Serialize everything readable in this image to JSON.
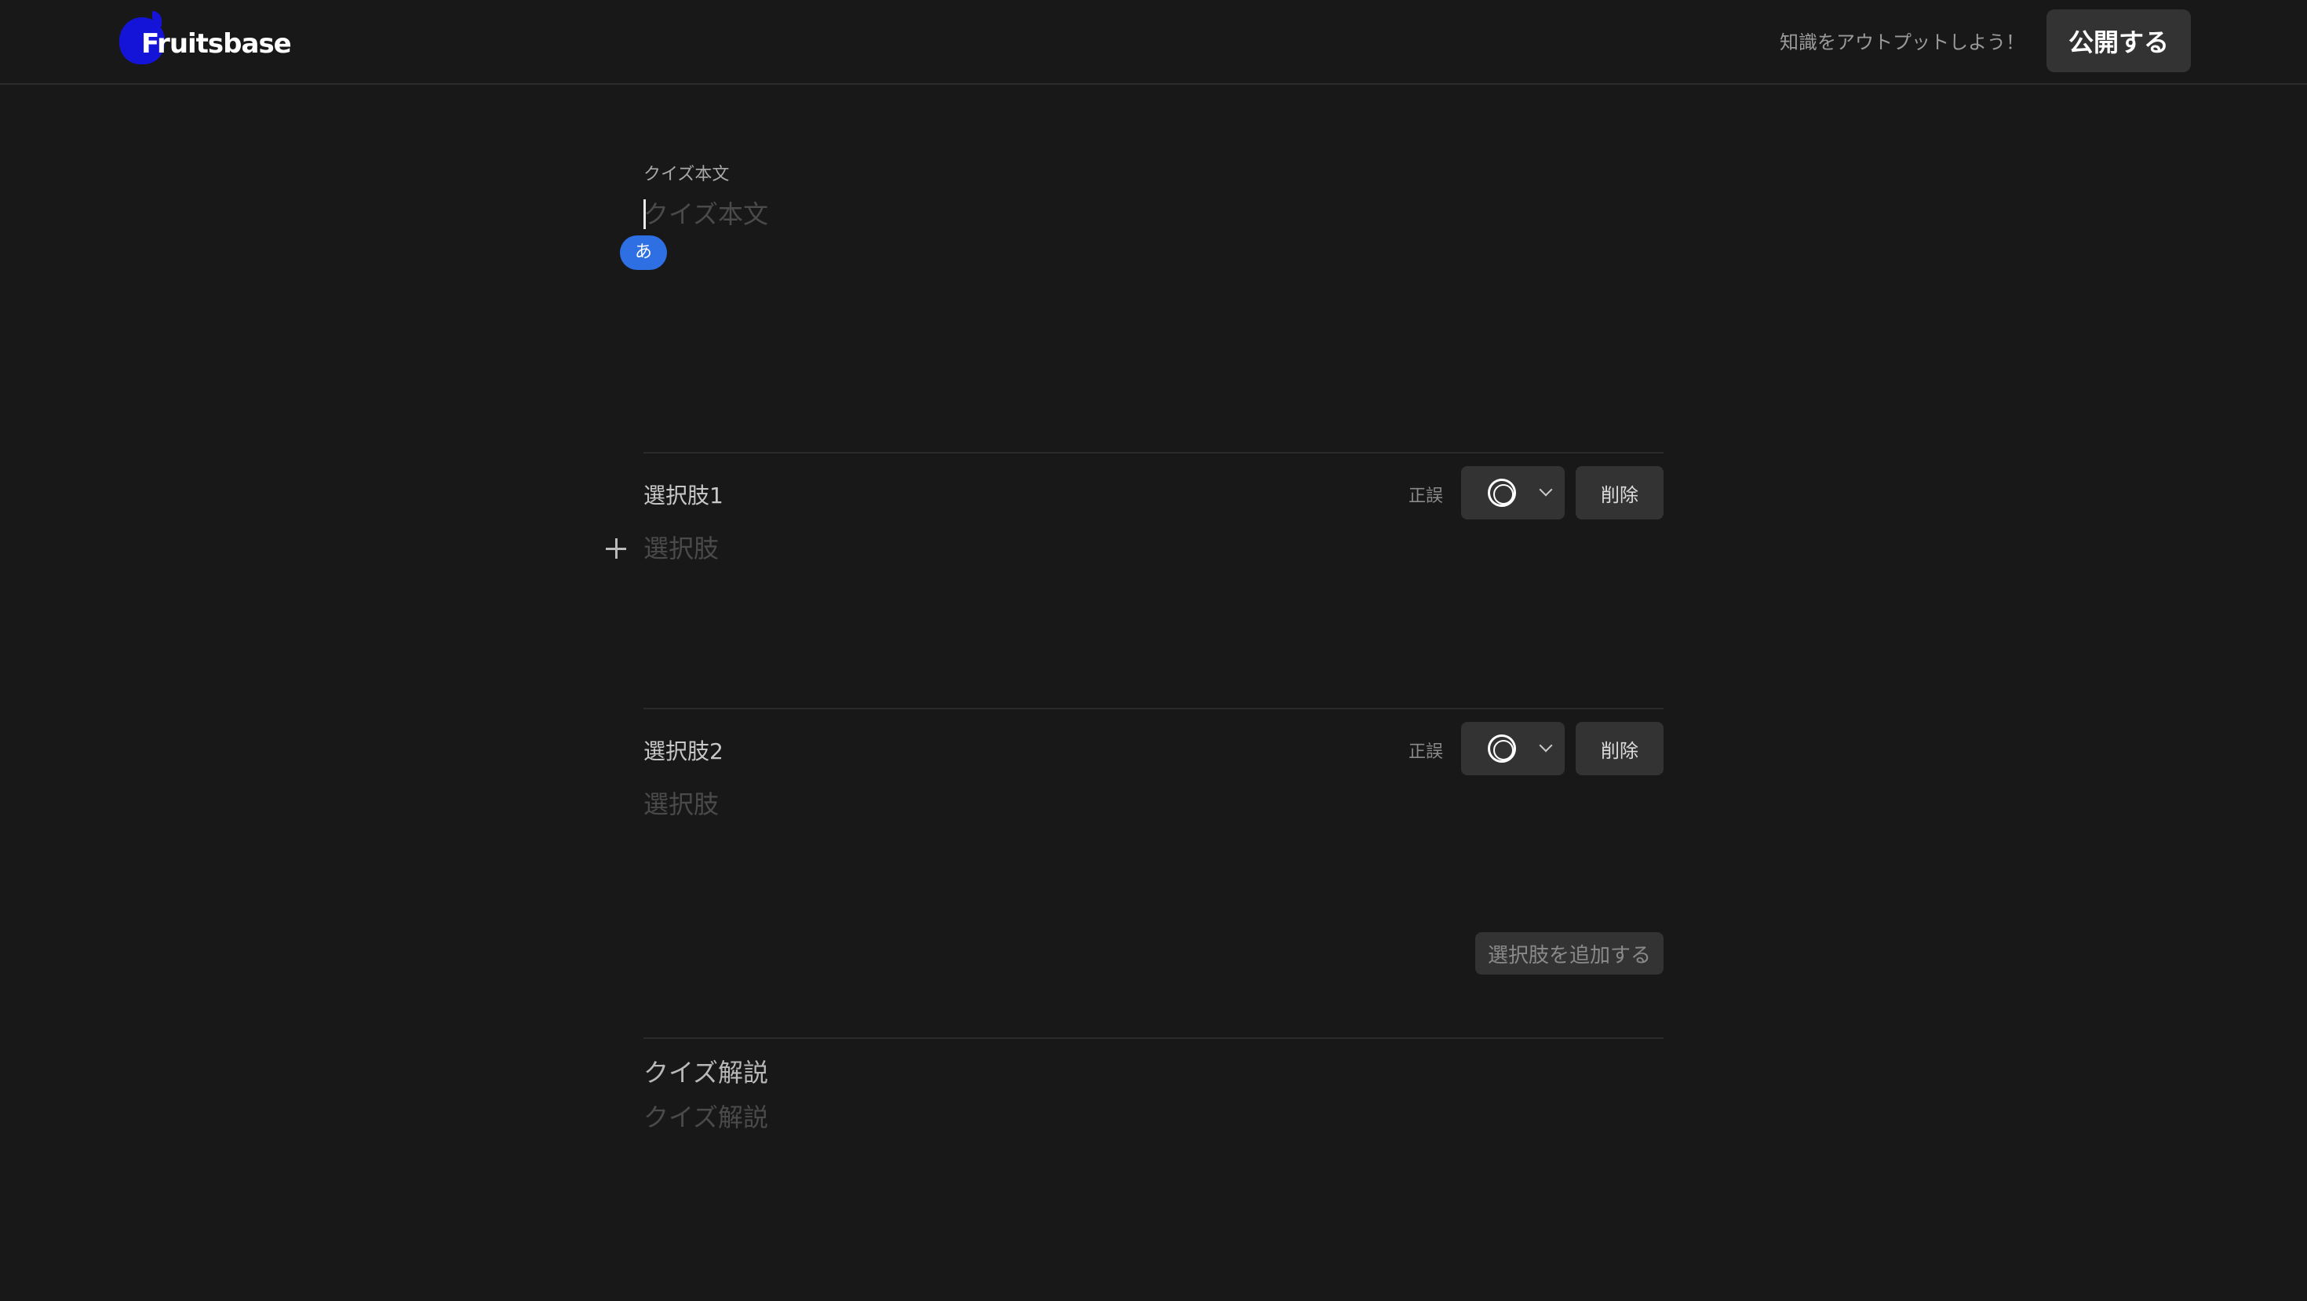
{
  "header": {
    "logo_text": "Fruitsbase",
    "tagline": "知識をアウトプットしよう！",
    "publish_label": "公開する"
  },
  "quiz": {
    "body_label": "クイズ本文",
    "body_placeholder": "クイズ本文",
    "ime_indicator": "あ"
  },
  "choices": [
    {
      "label": "選択肢1",
      "tf_label": "正誤",
      "tf_value": "◎",
      "delete_label": "削除",
      "placeholder": "選択肢"
    },
    {
      "label": "選択肢2",
      "tf_label": "正誤",
      "tf_value": "◎",
      "delete_label": "削除",
      "placeholder": "選択肢"
    }
  ],
  "add_choice_label": "選択肢を追加する",
  "explanation": {
    "label": "クイズ解説",
    "placeholder": "クイズ解説"
  },
  "colors": {
    "background": "#181818",
    "brand": "#1414d8",
    "ime_badge": "#2f6fe4",
    "button": "#333333"
  }
}
